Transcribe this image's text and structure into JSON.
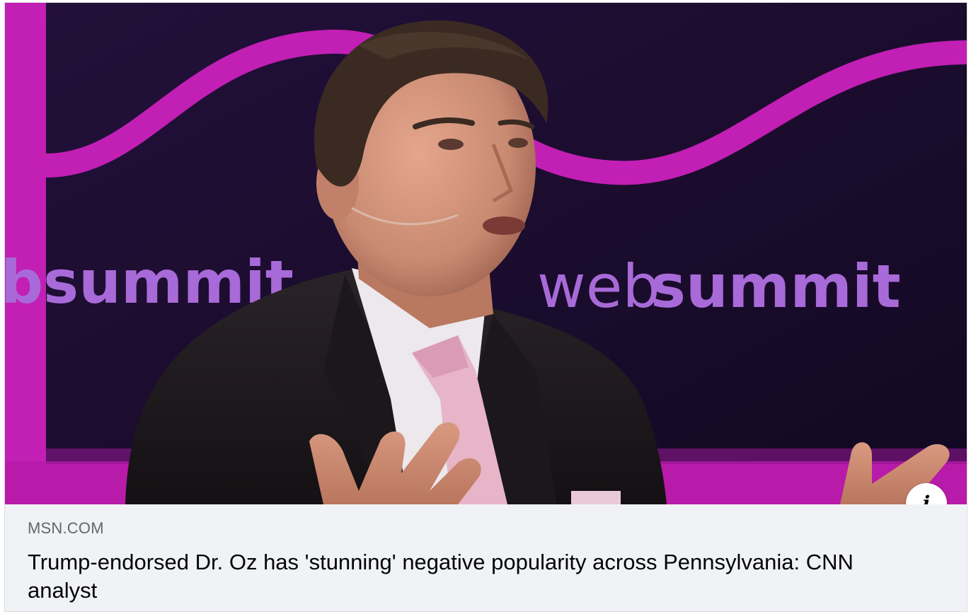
{
  "link_preview": {
    "image_alt": "Man in dark suit and pink tie speaking on stage in front of a web summit backdrop",
    "backdrop_text_left": "bsummit",
    "backdrop_text_right_light": "web",
    "backdrop_text_right_bold": "summit",
    "info_icon": "i",
    "domain": "MSN.COM",
    "headline": "Trump-endorsed Dr. Oz has 'stunning' negative popularity across Pennsylvania: CNN analyst"
  },
  "colors": {
    "backdrop": "#1c0f2e",
    "accent_magenta": "#c21fb4",
    "summit_text": "#a86ad8",
    "caption_bg": "#f0f2f5",
    "domain_text": "#65676b",
    "headline_text": "#050505"
  },
  "icons": {
    "info": "info-icon"
  }
}
